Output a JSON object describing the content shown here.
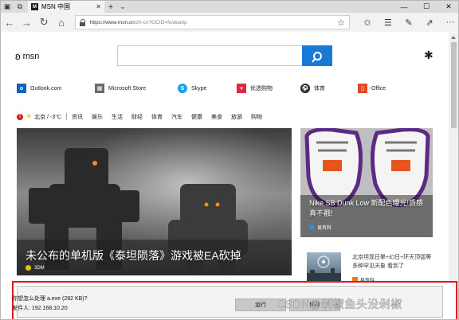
{
  "tab": {
    "title": "MSN 中国"
  },
  "addressbar": {
    "url_host": "https://www.msn.cn",
    "url_path": "/zh-cn?OCID=fwdbahp"
  },
  "page": {
    "logo_text": "msn",
    "quicklinks": [
      {
        "label": "Outlook.com",
        "icon": "outlook-icon",
        "color": "#0a64c4"
      },
      {
        "label": "Microsoft Store",
        "icon": "store-icon",
        "color": "#6b6b6b"
      },
      {
        "label": "Skype",
        "icon": "skype-icon",
        "color": "#1aa1e6"
      },
      {
        "label": "优选购物",
        "icon": "shopping-icon",
        "color": "#e2283f"
      },
      {
        "label": "体育",
        "icon": "sports-icon",
        "color": "#222222"
      },
      {
        "label": "Office",
        "icon": "office-icon",
        "color": "#e04a1f"
      }
    ],
    "weather": "北京 / -3°C",
    "navlinks": [
      "资讯",
      "娱乐",
      "生活",
      "财经",
      "体育",
      "汽车",
      "健康",
      "美食",
      "旅游",
      "购物"
    ],
    "hero": {
      "title": "未公布的单机版《泰坦陨落》游戏被EA砍掉",
      "source": "3DM"
    },
    "card1": {
      "caption": "Nike SB Dunk Low 新配色曝光!质感真不戳!",
      "source": "易有料"
    },
    "card2": {
      "text": "北京坦现日晕+幻日+环天顶弧等多种罕见天象 看到了",
      "source": "易有料"
    }
  },
  "download": {
    "question": "你想怎么处理 a.exe (282 KB)?",
    "sender": "发件人: 192.168.10.20",
    "run_label": "运行",
    "save_label": "保存",
    "watermark": "CSDN@剁椒鱼头没剁椒"
  },
  "colors": {
    "accent": "#1a79d6",
    "highlight_border": "#e0191f"
  }
}
